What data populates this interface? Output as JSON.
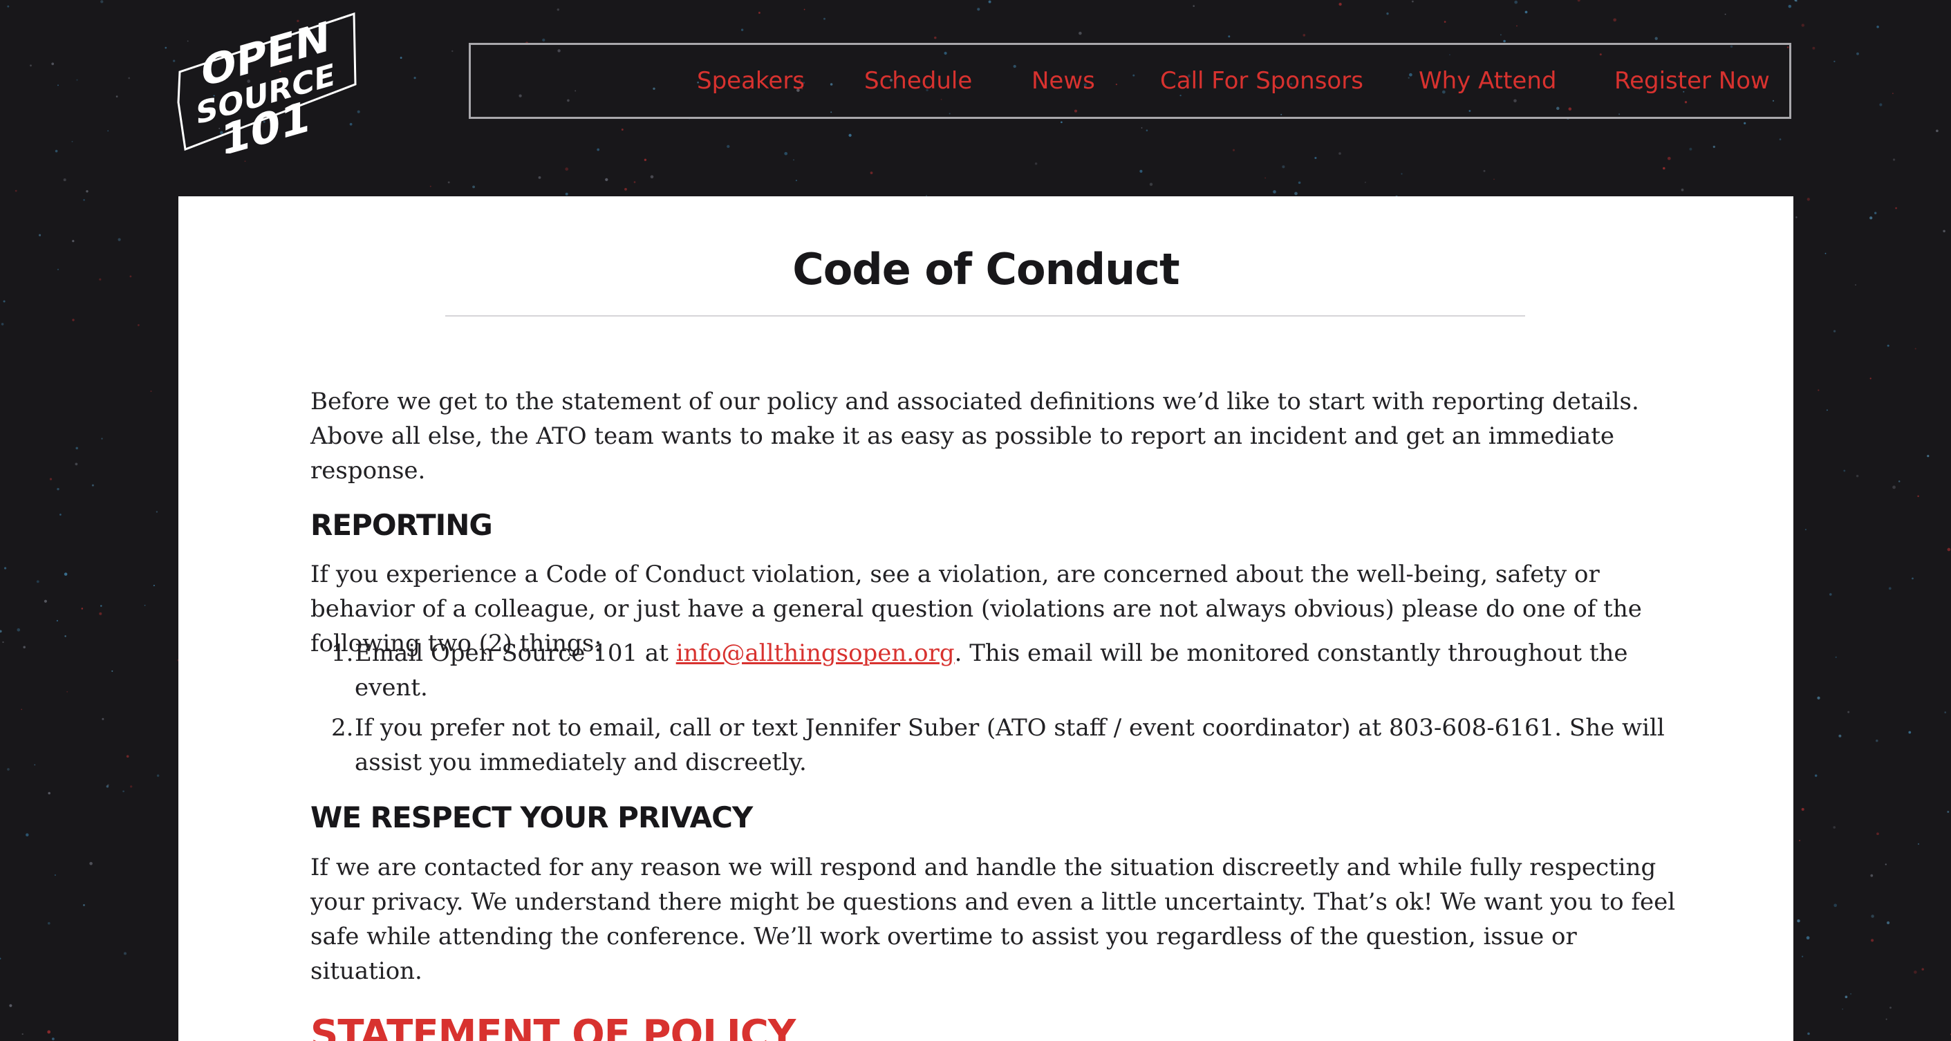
{
  "colors": {
    "background": "#18171a",
    "accent": "#d8322f",
    "card": "#ffffff",
    "text": "#222124",
    "nav_border": "#a9a8ac"
  },
  "logo": {
    "line1": "OPEN",
    "line2": "SOURCE",
    "line3": "101"
  },
  "nav": {
    "items": [
      {
        "label": "Speakers"
      },
      {
        "label": "Schedule"
      },
      {
        "label": "News"
      },
      {
        "label": "Call For Sponsors"
      },
      {
        "label": "Why Attend"
      },
      {
        "label": "Register Now"
      }
    ]
  },
  "page": {
    "title": "Code of Conduct",
    "intro": "Before we get to the statement of our policy and associated definitions we’d like to start with reporting details. Above all else, the ATO team wants to make it as easy as possible to report an incident and get an immediate response.",
    "reporting": {
      "heading": "REPORTING",
      "body": "If you experience a Code of Conduct violation, see a violation, are concerned about the well-being, safety or behavior of a colleague, or just have a general question (violations are not always obvious) please do one of the following two (2) things:",
      "items": [
        {
          "number": "1.",
          "before": "Email Open Source 101 at ",
          "link": "info@allthingsopen.org",
          "after": ". This email will be monitored constantly throughout the event."
        },
        {
          "number": "2.",
          "text": "If you prefer not to email, call or text Jennifer Suber (ATO staff / event coordinator) at 803-608-6161. She will assist you immediately and discreetly."
        }
      ]
    },
    "privacy": {
      "heading": "WE RESPECT YOUR PRIVACY",
      "body": "If we are contacted for any reason we will respond and handle the situation discreetly and while fully respecting your privacy. We understand there might be questions and even a little uncertainty. That’s ok! We want you to feel safe while attending the conference. We’ll work overtime to assist you regardless of the question, issue or situation."
    },
    "policy_heading": "STATEMENT OF POLICY"
  }
}
